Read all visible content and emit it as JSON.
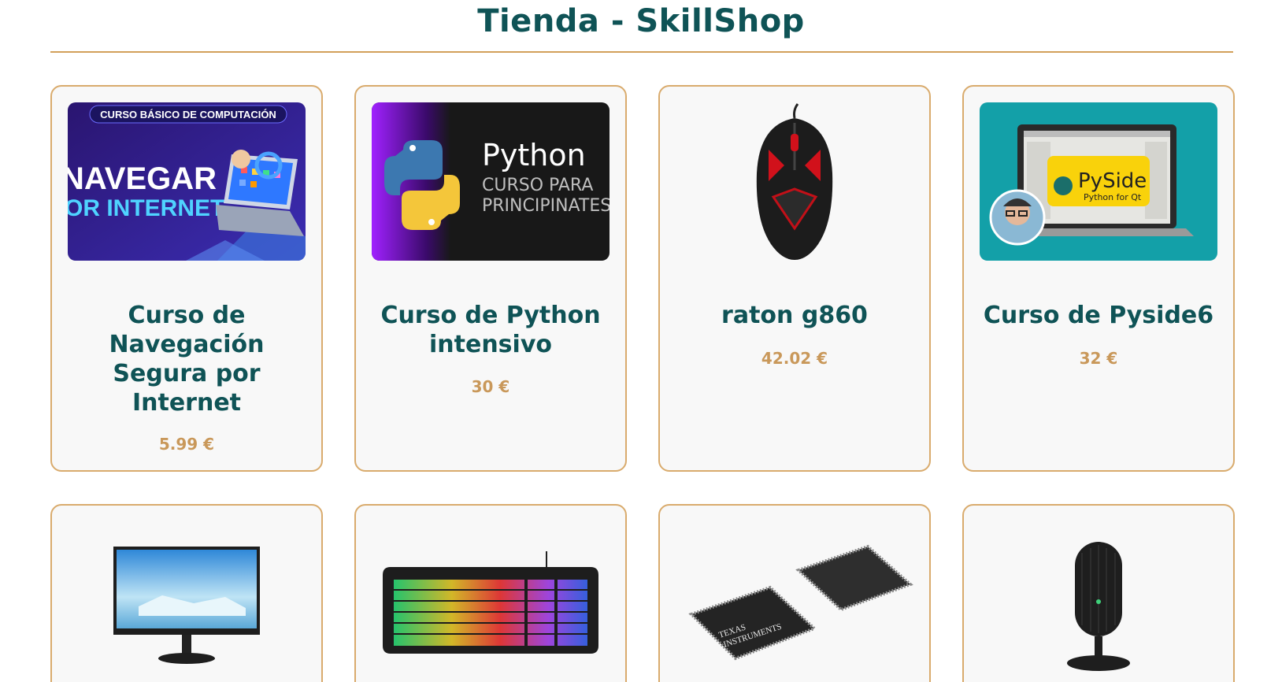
{
  "page": {
    "title": "Tienda - SkillShop"
  },
  "products": [
    {
      "name": "Curso de Navegación Segura por Internet",
      "price": "5.99 €",
      "image": {
        "banner": "CURSO BÁSICO DE COMPUTACIÓN",
        "line1": "NAVEGAR",
        "line2": "OR INTERNET"
      }
    },
    {
      "name": "Curso de Python intensivo",
      "price": "30 €",
      "image": {
        "title": "Python",
        "line1": "CURSO PARA",
        "line2": "PRINCIPINATES"
      }
    },
    {
      "name": "raton g860",
      "price": "42.02 €",
      "image": {
        "icon": "gaming-mouse"
      }
    },
    {
      "name": "Curso de Pyside6",
      "price": "32 €",
      "image": {
        "logo": "PySide",
        "tagline": "Python for Qt"
      }
    },
    {
      "name": "",
      "price": "",
      "image": {
        "icon": "monitor"
      }
    },
    {
      "name": "",
      "price": "",
      "image": {
        "icon": "rgb-keyboard"
      }
    },
    {
      "name": "",
      "price": "",
      "image": {
        "brand_line1": "TEXAS",
        "brand_line2": "INSTRUMENTS"
      }
    },
    {
      "name": "",
      "price": "",
      "image": {
        "icon": "microphone"
      }
    }
  ],
  "colors": {
    "title": "#0f5356",
    "accent": "#d2a05a",
    "price": "#c9985a",
    "card_bg": "#f8f8f8"
  }
}
